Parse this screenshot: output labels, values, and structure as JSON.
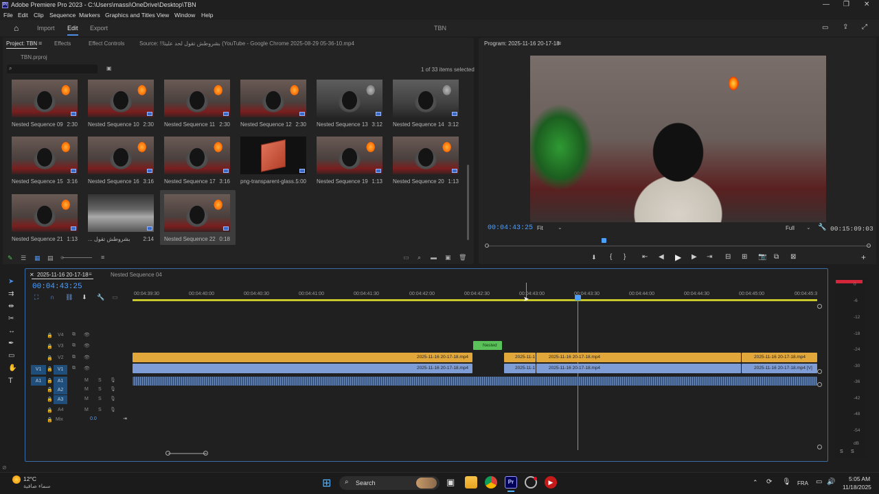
{
  "window": {
    "title": "Adobe Premiere Pro 2023 - C:\\Users\\massi\\OneDrive\\Desktop\\TBN",
    "controls": [
      "—",
      "❐",
      "✕"
    ]
  },
  "menu": [
    "File",
    "Edit",
    "Clip",
    "Sequence",
    "Markers",
    "Graphics and Titles",
    "View",
    "Window",
    "Help"
  ],
  "workspace": {
    "tabs": [
      "Import",
      "Edit",
      "Export"
    ],
    "active_tab": "Edit",
    "project_name": "TBN"
  },
  "project_panel": {
    "tabs": [
      "Project: TBN",
      "Effects",
      "Effect Controls"
    ],
    "source_label": "Source: !!بشروطش تقول لحد عليتا (YouTube - Google Chrome 2025-08-29 05-36-10.mp4",
    "project_file": "TBN.prproj",
    "search_placeholder": "",
    "selection_status": "1 of 33 items selected",
    "items": [
      {
        "name": "Nested Sequence 09",
        "duration": "2:30"
      },
      {
        "name": "Nested Sequence 10",
        "duration": "2:30"
      },
      {
        "name": "Nested Sequence 11",
        "duration": "2:30"
      },
      {
        "name": "Nested Sequence 12",
        "duration": "2:30"
      },
      {
        "name": "Nested Sequence 13",
        "duration": "3:12"
      },
      {
        "name": "Nested Sequence 14",
        "duration": "3:12"
      },
      {
        "name": "Nested Sequence 15",
        "duration": "3:16"
      },
      {
        "name": "Nested Sequence 16",
        "duration": "3:16"
      },
      {
        "name": "Nested Sequence 17",
        "duration": "3:16"
      },
      {
        "name": "png-transparent-glass...",
        "duration": "5:00"
      },
      {
        "name": "Nested Sequence 19",
        "duration": "1:13"
      },
      {
        "name": "Nested Sequence 20",
        "duration": "1:13"
      },
      {
        "name": "Nested Sequence 21",
        "duration": "1:13"
      },
      {
        "name": "... بشروطش تقول",
        "duration": "2:14"
      },
      {
        "name": "Nested Sequence 22",
        "duration": "0:18"
      }
    ]
  },
  "program_monitor": {
    "title": "Program: 2025-11-16 20-17-18",
    "timecode": "00:04:43:25",
    "fit": "Fit",
    "quality": "Full",
    "duration": "00:15:09:03"
  },
  "timeline": {
    "tabs": [
      "2025-11-16 20-17-18",
      "Nested Sequence 04"
    ],
    "timecode": "00:04:43:25",
    "ruler": [
      "00:04:39:30",
      "00:04:40:00",
      "00:04:40:30",
      "00:04:41:00",
      "00:04:41:30",
      "00:04:42:00",
      "00:04:42:30",
      "00:04:43:00",
      "00:04:43:30",
      "00:04:44:00",
      "00:04:44:30",
      "00:04:45:00",
      "00:04:45:3"
    ],
    "video_tracks": [
      "V4",
      "V3",
      "V2",
      "V1"
    ],
    "audio_tracks": [
      "A1",
      "A2",
      "A3",
      "A4"
    ],
    "source_patch": [
      "V1",
      "A1"
    ],
    "mix_label": "Mix",
    "mix_value": "0.0",
    "track_m": "M",
    "track_s": "S",
    "clips": {
      "nested": "Nested",
      "v2_a": "2025-11-16 20-17-18.mp4",
      "v2_b": "2025-11-1",
      "v2_c": "2025-11-16 20-17-18.mp4",
      "v2_d": "2025-11-16 20-17-18.mp4",
      "v1_a": "2025-11-16 20-17-18.mp4",
      "v1_b": "2025-11-1",
      "v1_c": "2025-11-16 20-17-18.mp4",
      "v1_d": "2025-11-16 20-17-18.mp4 [V]"
    }
  },
  "meter": {
    "scale": [
      "0",
      "-6",
      "-12",
      "-18",
      "-24",
      "-30",
      "-36",
      "-42",
      "-48",
      "-54",
      "dB"
    ],
    "solo": [
      "S",
      "S"
    ]
  },
  "taskbar": {
    "weather_temp": "12°C",
    "weather_desc": "سماء صافية",
    "search": "Search",
    "language": "FRA",
    "time": "5:05 AM",
    "date": "11/18/2025"
  },
  "colors": {
    "accent": "#4b8ee8",
    "timecode": "#4ea0ff",
    "video_clip": "#e2a73a",
    "v1_clip": "#7e9dd6",
    "nested_clip": "#5ac05a",
    "playhead": "#4ea0ff",
    "meter_peak": "#d4263b"
  }
}
